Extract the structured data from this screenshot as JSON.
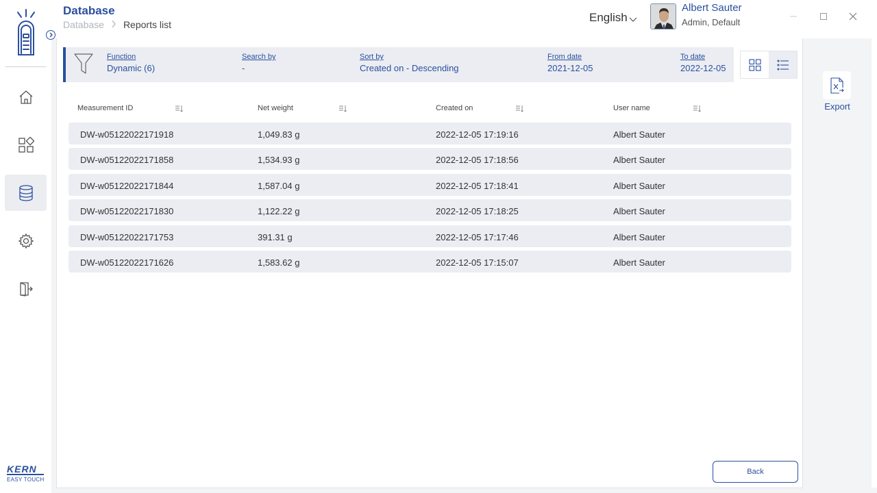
{
  "header": {
    "title": "Database",
    "breadcrumb": [
      "Database",
      "Reports list"
    ],
    "language": "English",
    "user": {
      "name": "Albert Sauter",
      "role": "Admin, Default"
    }
  },
  "nav": {
    "items": [
      {
        "name": "home",
        "icon": "home-icon"
      },
      {
        "name": "apps",
        "icon": "grid-icon"
      },
      {
        "name": "database",
        "icon": "database-icon",
        "active": true
      },
      {
        "name": "settings",
        "icon": "gear-icon"
      },
      {
        "name": "logout",
        "icon": "logout-icon"
      }
    ],
    "brand": {
      "line1": "KERN",
      "line2": "EASY TOUCH"
    }
  },
  "filter": {
    "function": {
      "label": "Function",
      "value": "Dynamic (6)"
    },
    "search_by": {
      "label": "Search by",
      "value": "-"
    },
    "sort_by": {
      "label": "Sort by",
      "value": "Created on - Descending"
    },
    "from_date": {
      "label": "From date",
      "value": "2021-12-05"
    },
    "to_date": {
      "label": "To date",
      "value": "2022-12-05"
    }
  },
  "table": {
    "columns": [
      "Measurement ID",
      "Net weight",
      "Created on",
      "User name"
    ],
    "rows": [
      [
        "DW-w05122022171918",
        "1,049.83 g",
        "2022-12-05 17:19:16",
        "Albert Sauter"
      ],
      [
        "DW-w05122022171858",
        "1,534.93 g",
        "2022-12-05 17:18:56",
        "Albert Sauter"
      ],
      [
        "DW-w05122022171844",
        "1,587.04 g",
        "2022-12-05 17:18:41",
        "Albert Sauter"
      ],
      [
        "DW-w05122022171830",
        "1,122.22 g",
        "2022-12-05 17:18:25",
        "Albert Sauter"
      ],
      [
        "DW-w05122022171753",
        "391.31 g",
        "2022-12-05 17:17:46",
        "Albert Sauter"
      ],
      [
        "DW-w05122022171626",
        "1,583.62 g",
        "2022-12-05 17:15:07",
        "Albert Sauter"
      ]
    ]
  },
  "actions": {
    "export_label": "Export",
    "back_label": "Back"
  },
  "colors": {
    "accent": "#2a4f9e",
    "row_bg": "#ebedf3",
    "panel_bg": "#f3f4f6"
  }
}
